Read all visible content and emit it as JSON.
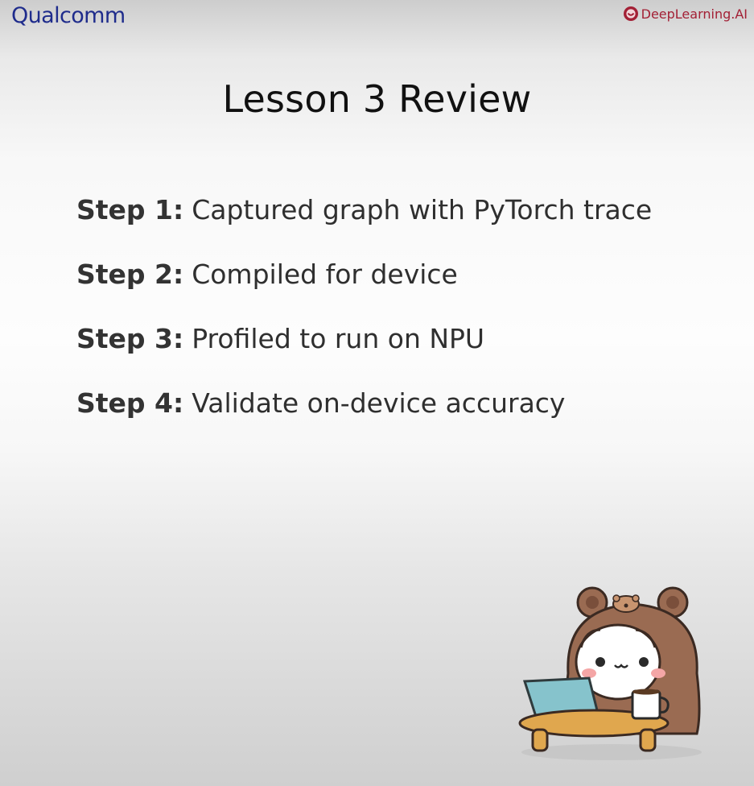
{
  "header": {
    "brand_left": "Qualcomm",
    "brand_right": "DeepLearning.AI"
  },
  "slide": {
    "title": "Lesson 3 Review",
    "steps": [
      {
        "label": "Step 1:",
        "text": "Captured graph with PyTorch trace"
      },
      {
        "label": "Step 2:",
        "text": "Compiled for device"
      },
      {
        "label": "Step 3:",
        "text": "Profiled to run on NPU"
      },
      {
        "label": "Step 4:",
        "text": "Validate on-device accuracy"
      }
    ]
  },
  "illustration": {
    "icon": "bear-mascot-with-laptop-icon"
  },
  "colors": {
    "qualcomm_blue": "#1f2c8c",
    "deeplearning_red": "#a32035",
    "bear_brown": "#9a6b52",
    "laptop_teal": "#86c3cc"
  }
}
